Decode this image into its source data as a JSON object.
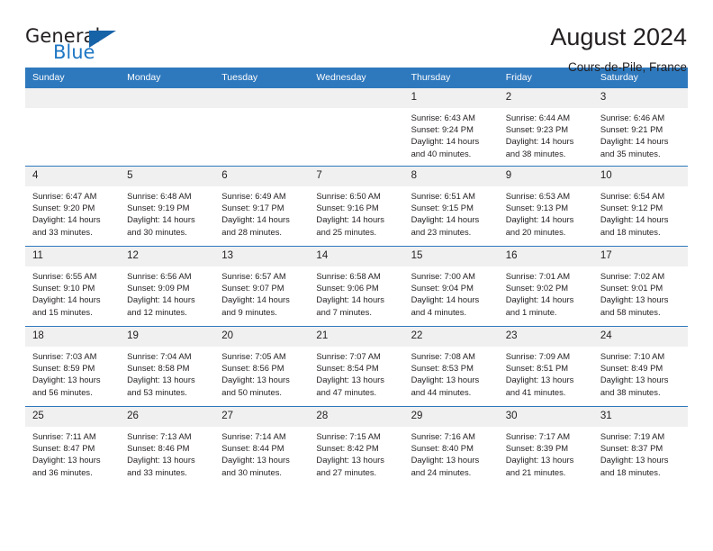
{
  "brand": {
    "name_part1": "General",
    "name_part2": "Blue",
    "accent_color": "#1763a8",
    "text_color": "#1e77c4"
  },
  "header": {
    "title": "August 2024",
    "subtitle": "Cours-de-Pile, France"
  },
  "theme": {
    "header_row_bg": "#2e78bd",
    "daynum_bg": "#f0f0f0",
    "cell_bg": "#ffffff",
    "text": "#231f20"
  },
  "weekday_headers": [
    "Sunday",
    "Monday",
    "Tuesday",
    "Wednesday",
    "Thursday",
    "Friday",
    "Saturday"
  ],
  "weeks": [
    [
      {
        "day": "",
        "sunrise": "",
        "sunset": "",
        "daylight": "",
        "empty": true
      },
      {
        "day": "",
        "sunrise": "",
        "sunset": "",
        "daylight": "",
        "empty": true
      },
      {
        "day": "",
        "sunrise": "",
        "sunset": "",
        "daylight": "",
        "empty": true
      },
      {
        "day": "",
        "sunrise": "",
        "sunset": "",
        "daylight": "",
        "empty": true
      },
      {
        "day": "1",
        "sunrise": "Sunrise: 6:43 AM",
        "sunset": "Sunset: 9:24 PM",
        "daylight": "Daylight: 14 hours and 40 minutes."
      },
      {
        "day": "2",
        "sunrise": "Sunrise: 6:44 AM",
        "sunset": "Sunset: 9:23 PM",
        "daylight": "Daylight: 14 hours and 38 minutes."
      },
      {
        "day": "3",
        "sunrise": "Sunrise: 6:46 AM",
        "sunset": "Sunset: 9:21 PM",
        "daylight": "Daylight: 14 hours and 35 minutes."
      }
    ],
    [
      {
        "day": "4",
        "sunrise": "Sunrise: 6:47 AM",
        "sunset": "Sunset: 9:20 PM",
        "daylight": "Daylight: 14 hours and 33 minutes."
      },
      {
        "day": "5",
        "sunrise": "Sunrise: 6:48 AM",
        "sunset": "Sunset: 9:19 PM",
        "daylight": "Daylight: 14 hours and 30 minutes."
      },
      {
        "day": "6",
        "sunrise": "Sunrise: 6:49 AM",
        "sunset": "Sunset: 9:17 PM",
        "daylight": "Daylight: 14 hours and 28 minutes."
      },
      {
        "day": "7",
        "sunrise": "Sunrise: 6:50 AM",
        "sunset": "Sunset: 9:16 PM",
        "daylight": "Daylight: 14 hours and 25 minutes."
      },
      {
        "day": "8",
        "sunrise": "Sunrise: 6:51 AM",
        "sunset": "Sunset: 9:15 PM",
        "daylight": "Daylight: 14 hours and 23 minutes."
      },
      {
        "day": "9",
        "sunrise": "Sunrise: 6:53 AM",
        "sunset": "Sunset: 9:13 PM",
        "daylight": "Daylight: 14 hours and 20 minutes."
      },
      {
        "day": "10",
        "sunrise": "Sunrise: 6:54 AM",
        "sunset": "Sunset: 9:12 PM",
        "daylight": "Daylight: 14 hours and 18 minutes."
      }
    ],
    [
      {
        "day": "11",
        "sunrise": "Sunrise: 6:55 AM",
        "sunset": "Sunset: 9:10 PM",
        "daylight": "Daylight: 14 hours and 15 minutes."
      },
      {
        "day": "12",
        "sunrise": "Sunrise: 6:56 AM",
        "sunset": "Sunset: 9:09 PM",
        "daylight": "Daylight: 14 hours and 12 minutes."
      },
      {
        "day": "13",
        "sunrise": "Sunrise: 6:57 AM",
        "sunset": "Sunset: 9:07 PM",
        "daylight": "Daylight: 14 hours and 9 minutes."
      },
      {
        "day": "14",
        "sunrise": "Sunrise: 6:58 AM",
        "sunset": "Sunset: 9:06 PM",
        "daylight": "Daylight: 14 hours and 7 minutes."
      },
      {
        "day": "15",
        "sunrise": "Sunrise: 7:00 AM",
        "sunset": "Sunset: 9:04 PM",
        "daylight": "Daylight: 14 hours and 4 minutes."
      },
      {
        "day": "16",
        "sunrise": "Sunrise: 7:01 AM",
        "sunset": "Sunset: 9:02 PM",
        "daylight": "Daylight: 14 hours and 1 minute."
      },
      {
        "day": "17",
        "sunrise": "Sunrise: 7:02 AM",
        "sunset": "Sunset: 9:01 PM",
        "daylight": "Daylight: 13 hours and 58 minutes."
      }
    ],
    [
      {
        "day": "18",
        "sunrise": "Sunrise: 7:03 AM",
        "sunset": "Sunset: 8:59 PM",
        "daylight": "Daylight: 13 hours and 56 minutes."
      },
      {
        "day": "19",
        "sunrise": "Sunrise: 7:04 AM",
        "sunset": "Sunset: 8:58 PM",
        "daylight": "Daylight: 13 hours and 53 minutes."
      },
      {
        "day": "20",
        "sunrise": "Sunrise: 7:05 AM",
        "sunset": "Sunset: 8:56 PM",
        "daylight": "Daylight: 13 hours and 50 minutes."
      },
      {
        "day": "21",
        "sunrise": "Sunrise: 7:07 AM",
        "sunset": "Sunset: 8:54 PM",
        "daylight": "Daylight: 13 hours and 47 minutes."
      },
      {
        "day": "22",
        "sunrise": "Sunrise: 7:08 AM",
        "sunset": "Sunset: 8:53 PM",
        "daylight": "Daylight: 13 hours and 44 minutes."
      },
      {
        "day": "23",
        "sunrise": "Sunrise: 7:09 AM",
        "sunset": "Sunset: 8:51 PM",
        "daylight": "Daylight: 13 hours and 41 minutes."
      },
      {
        "day": "24",
        "sunrise": "Sunrise: 7:10 AM",
        "sunset": "Sunset: 8:49 PM",
        "daylight": "Daylight: 13 hours and 38 minutes."
      }
    ],
    [
      {
        "day": "25",
        "sunrise": "Sunrise: 7:11 AM",
        "sunset": "Sunset: 8:47 PM",
        "daylight": "Daylight: 13 hours and 36 minutes."
      },
      {
        "day": "26",
        "sunrise": "Sunrise: 7:13 AM",
        "sunset": "Sunset: 8:46 PM",
        "daylight": "Daylight: 13 hours and 33 minutes."
      },
      {
        "day": "27",
        "sunrise": "Sunrise: 7:14 AM",
        "sunset": "Sunset: 8:44 PM",
        "daylight": "Daylight: 13 hours and 30 minutes."
      },
      {
        "day": "28",
        "sunrise": "Sunrise: 7:15 AM",
        "sunset": "Sunset: 8:42 PM",
        "daylight": "Daylight: 13 hours and 27 minutes."
      },
      {
        "day": "29",
        "sunrise": "Sunrise: 7:16 AM",
        "sunset": "Sunset: 8:40 PM",
        "daylight": "Daylight: 13 hours and 24 minutes."
      },
      {
        "day": "30",
        "sunrise": "Sunrise: 7:17 AM",
        "sunset": "Sunset: 8:39 PM",
        "daylight": "Daylight: 13 hours and 21 minutes."
      },
      {
        "day": "31",
        "sunrise": "Sunrise: 7:19 AM",
        "sunset": "Sunset: 8:37 PM",
        "daylight": "Daylight: 13 hours and 18 minutes."
      }
    ]
  ]
}
